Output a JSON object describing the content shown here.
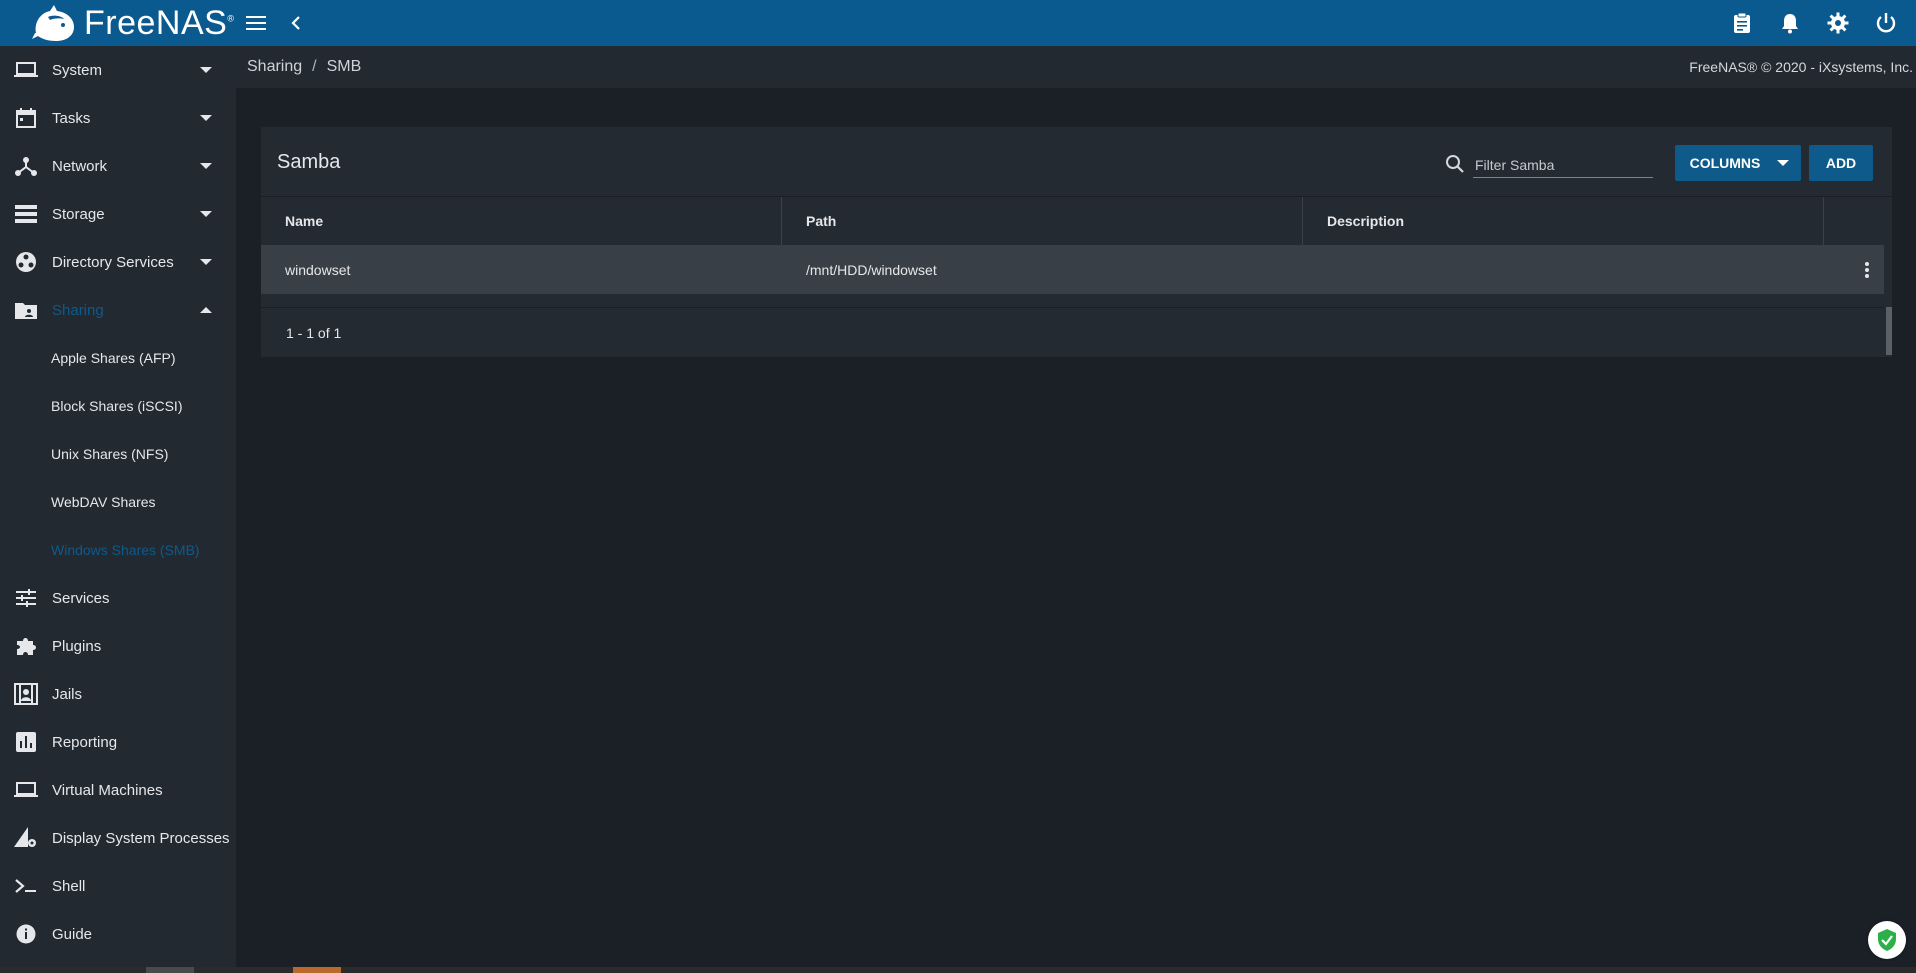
{
  "app": {
    "logo_text": "FreeNAS",
    "logo_mark": "®"
  },
  "topbar": {
    "menu_icon": "menu-icon",
    "back_icon": "chevron-left-icon",
    "right_icons": [
      "clipboard-icon",
      "bell-icon",
      "gear-icon",
      "power-icon"
    ]
  },
  "breadcrumb": {
    "items": [
      "Sharing",
      "SMB"
    ],
    "separator": "/",
    "copyright": "FreeNAS® © 2020 - iXsystems, Inc."
  },
  "sidebar": {
    "items": [
      {
        "label": "System",
        "icon": "laptop-icon",
        "expandable": true
      },
      {
        "label": "Tasks",
        "icon": "calendar-icon",
        "expandable": true
      },
      {
        "label": "Network",
        "icon": "network-icon",
        "expandable": true
      },
      {
        "label": "Storage",
        "icon": "storage-icon",
        "expandable": true
      },
      {
        "label": "Directory Services",
        "icon": "directory-icon",
        "expandable": true
      },
      {
        "label": "Sharing",
        "icon": "shared-folder-icon",
        "expandable": true,
        "expanded": true,
        "active": true
      },
      {
        "label": "Services",
        "icon": "sliders-icon"
      },
      {
        "label": "Plugins",
        "icon": "puzzle-icon"
      },
      {
        "label": "Jails",
        "icon": "jail-icon"
      },
      {
        "label": "Reporting",
        "icon": "chart-icon"
      },
      {
        "label": "Virtual Machines",
        "icon": "laptop-icon"
      },
      {
        "label": "Display System Processes",
        "icon": "processes-icon"
      },
      {
        "label": "Shell",
        "icon": "terminal-icon"
      },
      {
        "label": "Guide",
        "icon": "info-icon"
      }
    ],
    "sharing_children": [
      {
        "label": "Apple Shares (AFP)"
      },
      {
        "label": "Block Shares (iSCSI)"
      },
      {
        "label": "Unix Shares (NFS)"
      },
      {
        "label": "WebDAV Shares"
      },
      {
        "label": "Windows Shares (SMB)",
        "active": true
      }
    ]
  },
  "card": {
    "title": "Samba",
    "filter_placeholder": "Filter Samba",
    "columns_label": "COLUMNS",
    "add_label": "ADD",
    "headers": [
      "Name",
      "Path",
      "Description"
    ],
    "rows": [
      {
        "name": "windowset",
        "path": "/mnt/HDD/windowset",
        "description": ""
      }
    ],
    "pager": "1 - 1 of 1"
  },
  "colors": {
    "topbar": "#0b5a8f",
    "sidebar": "#232931",
    "accent": "#0d5a8b",
    "background": "#1b2027"
  }
}
